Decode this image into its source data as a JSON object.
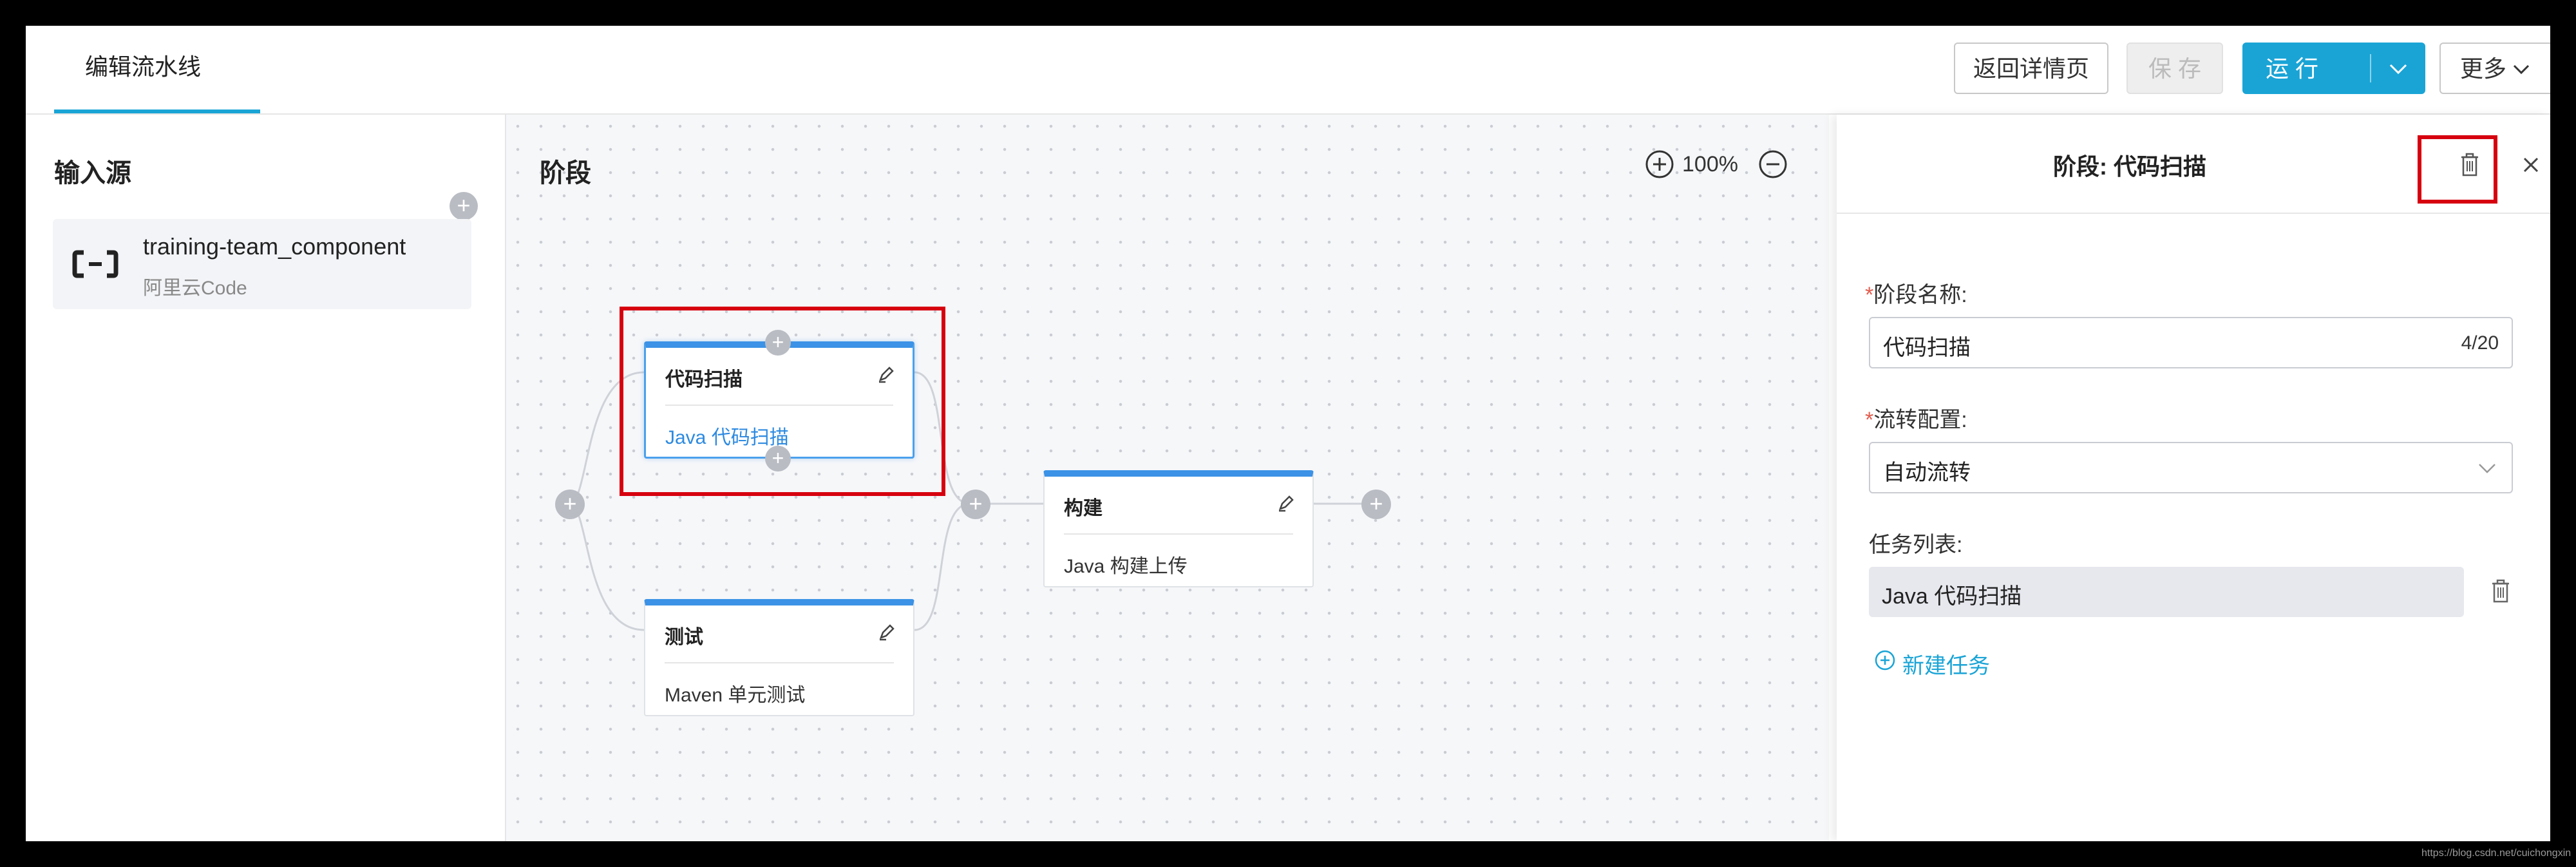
{
  "header": {
    "tab_label": "编辑流水线",
    "back_button": "返回详情页",
    "save_button": "保 存",
    "run_button": "运 行",
    "more_button": "更多"
  },
  "sources": {
    "title": "输入源",
    "add_label": "+",
    "items": [
      {
        "name": "training-team_component",
        "provider": "阿里云Code"
      }
    ]
  },
  "canvas": {
    "title": "阶段",
    "zoom": "100%",
    "zoom_in": "+",
    "zoom_out": "−",
    "add_label": "+",
    "stages": [
      {
        "name": "代码扫描",
        "task": "Java 代码扫描",
        "selected": true
      },
      {
        "name": "测试",
        "task": "Maven 单元测试",
        "selected": false
      },
      {
        "name": "构建",
        "task": "Java 构建上传",
        "selected": false
      }
    ]
  },
  "detail": {
    "title": "阶段: 代码扫描",
    "stage_name_label": "阶段名称:",
    "stage_name_value": "代码扫描",
    "stage_name_count": "4/20",
    "flow_label": "流转配置:",
    "flow_value": "自动流转",
    "task_list_label": "任务列表:",
    "tasks": [
      "Java 代码扫描"
    ],
    "new_task": "新建任务",
    "required_mark": "*"
  },
  "watermark": "https://blog.csdn.net/cuichongxin",
  "colors": {
    "accent": "#1aa4d6",
    "node_top": "#3b92e6",
    "highlight": "#d6000f",
    "link": "#1aa4d6"
  }
}
